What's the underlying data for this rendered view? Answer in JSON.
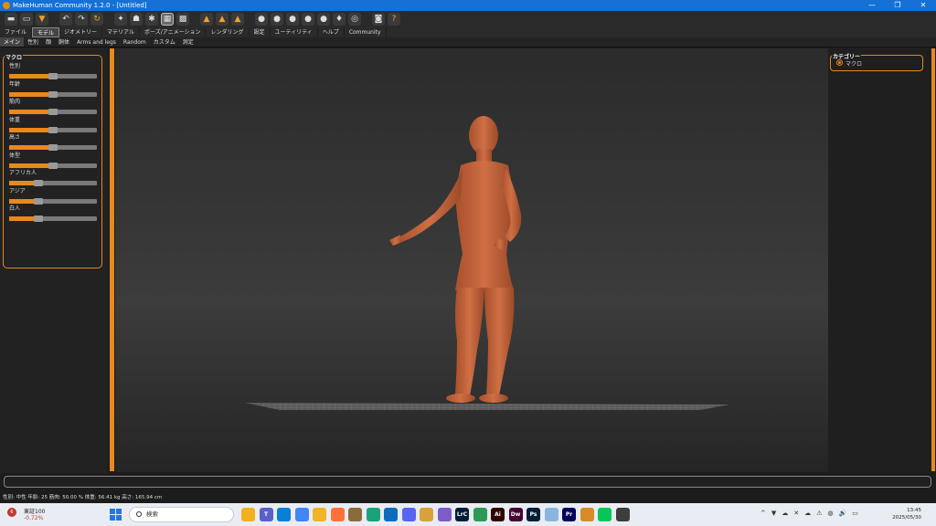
{
  "window": {
    "title": "MakeHuman Community 1.2.0 - [Untitled]",
    "controls": [
      "—",
      "❐",
      "✕"
    ]
  },
  "toolbar": {
    "icons": [
      "new-file-icon",
      "save-icon",
      "export-icon",
      "undo-icon",
      "redo-icon",
      "reset-icon",
      "smooth-icon",
      "wireframe-icon",
      "pose-icon",
      "grid-icon",
      "checker-icon",
      "front-view-icon",
      "side-view-icon",
      "top-view-icon",
      "head-front-icon",
      "head-side-icon",
      "head-back-icon",
      "head-top-icon",
      "head-icon",
      "head-alt-icon",
      "frame-icon",
      "screenshot-icon",
      "help-icon"
    ]
  },
  "menu": {
    "tabs": [
      "ファイル",
      "モデル",
      "ジオメトリー",
      "マテリアル",
      "ポーズ/アニメーション",
      "レンダリング",
      "設定",
      "ユーティリティ",
      "ヘルプ",
      "Community"
    ],
    "active": "モデル"
  },
  "subtabs": {
    "tabs": [
      "メイン",
      "性別",
      "顔",
      "胴体",
      "Arms and legs",
      "Random",
      "カスタム",
      "測定"
    ],
    "active": "メイン"
  },
  "left_panel": {
    "group_title": "マクロ",
    "sliders": [
      {
        "label": "性別",
        "value": 0.5
      },
      {
        "label": "年齢",
        "value": 0.5
      },
      {
        "label": "筋肉",
        "value": 0.5
      },
      {
        "label": "体重",
        "value": 0.5
      },
      {
        "label": "高さ",
        "value": 0.5
      },
      {
        "label": "体型",
        "value": 0.5
      },
      {
        "label": "アフリカ人",
        "value": 0.333
      },
      {
        "label": "アジア",
        "value": 0.333
      },
      {
        "label": "白人",
        "value": 0.333
      }
    ]
  },
  "right_panel": {
    "group_title": "カテゴリー",
    "option": "マクロ"
  },
  "status": "性別: 中性  年齢: 25  筋肉: 50.00 %  体重: 56.41 kg  高さ: 165.94 cm",
  "taskbar": {
    "weather_badge": "6",
    "stock_name": "東証100",
    "stock_change": "-0.72%",
    "search_placeholder": "検索",
    "apps": [
      {
        "name": "file-explorer-icon",
        "glyph": "",
        "color": "#f2b01e"
      },
      {
        "name": "teams-icon",
        "glyph": "T",
        "color": "#5b5fc7"
      },
      {
        "name": "store-icon",
        "glyph": "",
        "color": "#0a7fd6"
      },
      {
        "name": "chrome-icon",
        "glyph": "",
        "color": "#4285f4"
      },
      {
        "name": "folder-icon",
        "glyph": "",
        "color": "#f0b428"
      },
      {
        "name": "firefox-icon",
        "glyph": "",
        "color": "#ff7139"
      },
      {
        "name": "game-icon",
        "glyph": "",
        "color": "#8a6b3a"
      },
      {
        "name": "edge-icon",
        "glyph": "",
        "color": "#1aa37a"
      },
      {
        "name": "outlook-icon",
        "glyph": "",
        "color": "#0f6cbd"
      },
      {
        "name": "discord-icon",
        "glyph": "",
        "color": "#5865f2"
      },
      {
        "name": "makehuman-taskbar-icon",
        "glyph": "",
        "color": "#d8a23a"
      },
      {
        "name": "pen-icon",
        "glyph": "",
        "color": "#7b5cc9"
      },
      {
        "name": "lightroom-icon",
        "glyph": "LrC",
        "color": "#001e36"
      },
      {
        "name": "map-icon",
        "glyph": "",
        "color": "#2e9a55"
      },
      {
        "name": "illustrator-icon",
        "glyph": "Ai",
        "color": "#330000"
      },
      {
        "name": "dreamweaver-icon",
        "glyph": "Dw",
        "color": "#470137"
      },
      {
        "name": "photoshop-icon",
        "glyph": "Ps",
        "color": "#001e36"
      },
      {
        "name": "globe-icon",
        "glyph": "",
        "color": "#8bb5e0"
      },
      {
        "name": "premiere-icon",
        "glyph": "Pr",
        "color": "#00005b"
      },
      {
        "name": "paint-icon",
        "glyph": "",
        "color": "#d88a28"
      },
      {
        "name": "line-icon",
        "glyph": "",
        "color": "#06c755"
      },
      {
        "name": "makehuman-app-icon",
        "glyph": "",
        "color": "#3d3d3d"
      }
    ],
    "tray": [
      "^",
      "▼",
      "☁",
      "✕",
      "☁",
      "⚠",
      "◍",
      "🔊",
      "▭"
    ],
    "time": "13:45",
    "date": "2025/05/30"
  }
}
